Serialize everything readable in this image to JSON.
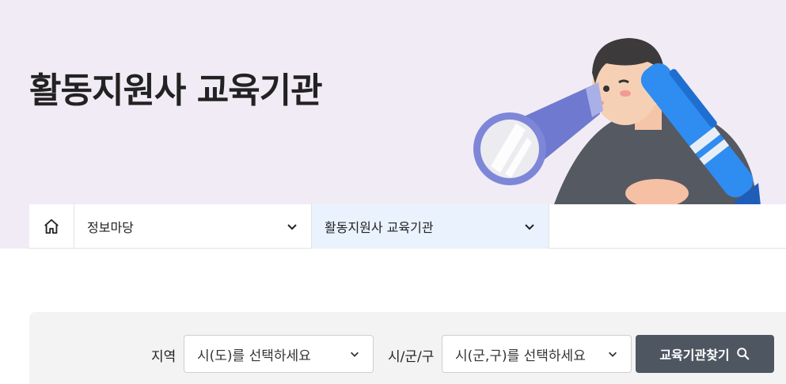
{
  "hero": {
    "title": "활동지원사 교육기관"
  },
  "breadcrumb": {
    "home_icon": "home-icon",
    "items": [
      {
        "label": "정보마당"
      },
      {
        "label": "활동지원사 교육기관"
      }
    ]
  },
  "search": {
    "region_label": "지역",
    "region_select_value": "시(도)를 선택하세요",
    "district_label": "시/군/구",
    "district_select_value": "시(군,구)를 선택하세요",
    "button_label": "교육기관찾기",
    "button_icon": "search-icon"
  },
  "colors": {
    "hero_bg": "#f1ebf6",
    "active_crumb_bg": "#eaf2fd",
    "search_button_bg": "#4e5662"
  }
}
